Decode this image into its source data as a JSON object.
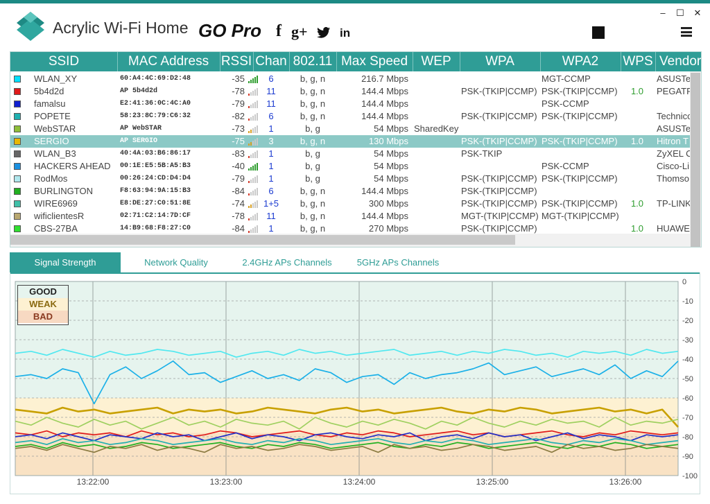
{
  "app": {
    "title": "Acrylic Wi-Fi Home",
    "edition": "GO Pro",
    "social": [
      "f",
      "g+",
      "twitter",
      "in"
    ],
    "window_buttons": [
      "–",
      "☐",
      "✕"
    ],
    "accent_color": "#2f9d96"
  },
  "table": {
    "columns": [
      "SSID",
      "MAC Address",
      "RSSI",
      "Chan",
      "802.11",
      "Max Speed",
      "WEP",
      "WPA",
      "WPA2",
      "WPS",
      "Vendor"
    ],
    "rows": [
      {
        "color": "#00e0ff",
        "ssid": "WLAN_XY",
        "mac": "60:A4:4C:69:D2:48",
        "rssi": "-35",
        "bars": 5,
        "chan": "6",
        "std": "b, g, n",
        "speed": "216.7 Mbps",
        "wep": "",
        "wpa": "",
        "wpa2": "MGT-CCMP",
        "wps": "",
        "vendor": "ASUSTe"
      },
      {
        "color": "#e01a1a",
        "ssid": "5b4d2d",
        "mac": "AP 5b4d2d",
        "rssi": "-78",
        "bars": 1,
        "chan": "11",
        "std": "b, g, n",
        "speed": "144.4 Mbps",
        "wep": "",
        "wpa": "PSK-(TKIP|CCMP)",
        "wpa2": "PSK-(TKIP|CCMP)",
        "wps": "1.0",
        "vendor": "PEGATR"
      },
      {
        "color": "#1020d0",
        "ssid": "famalsu",
        "mac": "E2:41:36:0C:4C:A0",
        "rssi": "-79",
        "bars": 1,
        "chan": "11",
        "std": "b, g, n",
        "speed": "144.4 Mbps",
        "wep": "",
        "wpa": "",
        "wpa2": "PSK-CCMP",
        "wps": "",
        "vendor": ""
      },
      {
        "color": "#1fb0b0",
        "ssid": "POPETE",
        "mac": "58:23:8C:79:C6:32",
        "rssi": "-82",
        "bars": 1,
        "chan": "6",
        "std": "b, g, n",
        "speed": "144.4 Mbps",
        "wep": "",
        "wpa": "PSK-(TKIP|CCMP)",
        "wpa2": "PSK-(TKIP|CCMP)",
        "wps": "",
        "vendor": "Technico"
      },
      {
        "color": "#8fbf3a",
        "ssid": "WebSTAR",
        "mac": "AP WebSTAR",
        "rssi": "-73",
        "bars": 2,
        "chan": "1",
        "std": "b, g",
        "speed": "54 Mbps",
        "wep": "SharedKey",
        "wpa": "",
        "wpa2": "",
        "wps": "",
        "vendor": "ASUSTe"
      },
      {
        "color": "#e8b800",
        "ssid": "SERGIO",
        "mac": "AP SERGIO",
        "rssi": "-75",
        "bars": 2,
        "chan": "3",
        "std": "b, g, n",
        "speed": "130 Mbps",
        "wep": "",
        "wpa": "PSK-(TKIP|CCMP)",
        "wpa2": "PSK-(TKIP|CCMP)",
        "wps": "1.0",
        "vendor": "Hitron T",
        "selected": true
      },
      {
        "color": "#666666",
        "ssid": "WLAN_B3",
        "mac": "40:4A:03:B6:86:17",
        "rssi": "-83",
        "bars": 1,
        "chan": "1",
        "std": "b, g",
        "speed": "54 Mbps",
        "wep": "",
        "wpa": "PSK-TKIP",
        "wpa2": "",
        "wps": "",
        "vendor": "ZyXEL C"
      },
      {
        "color": "#1a90e0",
        "ssid": "HACKERS AHEAD",
        "mac": "00:1E:E5:5B:A5:B3",
        "rssi": "-40",
        "bars": 5,
        "chan": "1",
        "std": "b, g",
        "speed": "54 Mbps",
        "wep": "",
        "wpa": "",
        "wpa2": "PSK-CCMP",
        "wps": "",
        "vendor": "Cisco-Li"
      },
      {
        "color": "#b0e8ee",
        "ssid": "RodMos",
        "mac": "00:26:24:CD:D4:D4",
        "rssi": "-79",
        "bars": 1,
        "chan": "1",
        "std": "b, g",
        "speed": "54 Mbps",
        "wep": "",
        "wpa": "PSK-(TKIP|CCMP)",
        "wpa2": "PSK-(TKIP|CCMP)",
        "wps": "",
        "vendor": "Thomso"
      },
      {
        "color": "#20b020",
        "ssid": "BURLINGTON",
        "mac": "F8:63:94:9A:15:B3",
        "rssi": "-84",
        "bars": 1,
        "chan": "6",
        "std": "b, g, n",
        "speed": "144.4 Mbps",
        "wep": "",
        "wpa": "PSK-(TKIP|CCMP)",
        "wpa2": "",
        "wps": "",
        "vendor": ""
      },
      {
        "color": "#40c0a8",
        "ssid": "WIRE6969",
        "mac": "E8:DE:27:C0:51:8E",
        "rssi": "-74",
        "bars": 2,
        "chan": "1+5",
        "std": "b, g, n",
        "speed": "300 Mbps",
        "wep": "",
        "wpa": "PSK-(TKIP|CCMP)",
        "wpa2": "PSK-(TKIP|CCMP)",
        "wps": "1.0",
        "vendor": "TP-LINK"
      },
      {
        "color": "#b8a870",
        "ssid": "wificlientesR",
        "mac": "02:71:C2:14:7D:CF",
        "rssi": "-78",
        "bars": 1,
        "chan": "11",
        "std": "b, g, n",
        "speed": "144.4 Mbps",
        "wep": "",
        "wpa": "MGT-(TKIP|CCMP)",
        "wpa2": "MGT-(TKIP|CCMP)",
        "wps": "",
        "vendor": ""
      },
      {
        "color": "#30e030",
        "ssid": "CBS-27BA",
        "mac": "14:B9:68:F8:27:C0",
        "rssi": "-84",
        "bars": 1,
        "chan": "1",
        "std": "b, g, n",
        "speed": "270 Mbps",
        "wep": "",
        "wpa": "PSK-(TKIP|CCMP)",
        "wpa2": "",
        "wps": "1.0",
        "vendor": "HUAWE"
      }
    ]
  },
  "tabs": [
    {
      "label": "Signal Strength",
      "active": true
    },
    {
      "label": "Network Quality",
      "active": false
    },
    {
      "label": "2.4GHz APs Channels",
      "active": false
    },
    {
      "label": "5GHz APs Channels",
      "active": false
    }
  ],
  "chart_data": {
    "type": "line",
    "ylim": [
      -100,
      0
    ],
    "yticks": [
      "0",
      "-10",
      "-20",
      "-30",
      "-40",
      "-50",
      "-60",
      "-70",
      "-80",
      "-90",
      "-100"
    ],
    "xticks": [
      "13:22:00",
      "13:23:00",
      "13:24:00",
      "13:25:00",
      "13:26:00"
    ],
    "legend": [
      "GOOD",
      "WEAK",
      "BAD"
    ],
    "zone_colors": {
      "good": "#e6f4ee",
      "weak": "#fdf1d2",
      "bad": "#f7d9c2"
    },
    "series": [
      {
        "color": "#50e8f0",
        "values": [
          -37,
          -36,
          -38,
          -35,
          -37,
          -39,
          -36,
          -38,
          -37,
          -35,
          -36,
          -38,
          -37,
          -36,
          -39,
          -37,
          -36,
          -38,
          -35,
          -37,
          -36,
          -38,
          -37,
          -36,
          -35,
          -38,
          -37,
          -36,
          -38,
          -36,
          -37,
          -35,
          -36,
          -38,
          -37,
          -39,
          -36,
          -37,
          -36,
          -38,
          -35,
          -37,
          -36
        ]
      },
      {
        "color": "#1ab0e8",
        "values": [
          -49,
          -48,
          -50,
          -45,
          -47,
          -63,
          -48,
          -44,
          -50,
          -46,
          -41,
          -48,
          -47,
          -52,
          -49,
          -46,
          -50,
          -48,
          -51,
          -45,
          -47,
          -52,
          -49,
          -48,
          -53,
          -47,
          -50,
          -48,
          -47,
          -45,
          -42,
          -48,
          -46,
          -44,
          -49,
          -47,
          -45,
          -48,
          -43,
          -50,
          -46,
          -49,
          -41
        ]
      },
      {
        "color": "#c8a000",
        "values": [
          -66,
          -67,
          -68,
          -65,
          -67,
          -66,
          -68,
          -67,
          -66,
          -65,
          -68,
          -66,
          -67,
          -66,
          -68,
          -67,
          -65,
          -66,
          -67,
          -68,
          -66,
          -65,
          -67,
          -66,
          -68,
          -67,
          -66,
          -65,
          -67,
          -68,
          -66,
          -67,
          -65,
          -66,
          -68,
          -67,
          -66,
          -65,
          -67,
          -66,
          -68,
          -66,
          -75
        ]
      },
      {
        "color": "#9fd060",
        "values": [
          -72,
          -74,
          -70,
          -73,
          -75,
          -71,
          -74,
          -72,
          -76,
          -73,
          -70,
          -74,
          -72,
          -75,
          -71,
          -73,
          -74,
          -72,
          -76,
          -70,
          -73,
          -75,
          -72,
          -74,
          -71,
          -73,
          -76,
          -72,
          -74,
          -70,
          -73,
          -75,
          -72,
          -74,
          -71,
          -73,
          -72,
          -75,
          -70,
          -74,
          -72,
          -73,
          -71
        ]
      },
      {
        "color": "#e01a1a",
        "values": [
          -78,
          -79,
          -77,
          -80,
          -78,
          -79,
          -78,
          -80,
          -77,
          -79,
          -78,
          -80,
          -79,
          -77,
          -78,
          -80,
          -79,
          -78,
          -77,
          -79,
          -80,
          -78,
          -79,
          -77,
          -78,
          -80,
          -79,
          -78,
          -77,
          -79,
          -78,
          -80,
          -79,
          -78,
          -77,
          -79,
          -80,
          -78,
          -79,
          -77,
          -78,
          -79,
          -78
        ]
      },
      {
        "color": "#2030c8",
        "values": [
          -80,
          -79,
          -81,
          -78,
          -80,
          -82,
          -79,
          -80,
          -81,
          -78,
          -80,
          -79,
          -82,
          -80,
          -78,
          -81,
          -79,
          -80,
          -82,
          -79,
          -78,
          -80,
          -81,
          -79,
          -80,
          -78,
          -82,
          -80,
          -79,
          -81,
          -78,
          -80,
          -79,
          -82,
          -80,
          -78,
          -81,
          -79,
          -80,
          -82,
          -79,
          -80,
          -79
        ]
      },
      {
        "color": "#20b0b0",
        "values": [
          -83,
          -82,
          -84,
          -81,
          -83,
          -82,
          -84,
          -83,
          -81,
          -82,
          -84,
          -83,
          -82,
          -81,
          -83,
          -84,
          -82,
          -83,
          -81,
          -82,
          -84,
          -83,
          -82,
          -81,
          -83,
          -84,
          -82,
          -83,
          -81,
          -82,
          -84,
          -83,
          -82,
          -81,
          -83,
          -84,
          -82,
          -83,
          -81,
          -82,
          -84,
          -83,
          -82
        ]
      },
      {
        "color": "#20b020",
        "values": [
          -85,
          -84,
          -86,
          -83,
          -85,
          -84,
          -86,
          -85,
          -83,
          -84,
          -86,
          -85,
          -84,
          -83,
          -85,
          -86,
          -84,
          -85,
          -83,
          -84,
          -86,
          -85,
          -84,
          -83,
          -85,
          -86,
          -84,
          -85,
          -83,
          -84,
          -86,
          -85,
          -84,
          -83,
          -85,
          -86,
          -84,
          -85,
          -83,
          -84,
          -86,
          -85,
          -84
        ]
      },
      {
        "color": "#8a7a40",
        "values": [
          -86,
          -85,
          -87,
          -84,
          -86,
          -88,
          -85,
          -86,
          -84,
          -87,
          -85,
          -86,
          -88,
          -84,
          -86,
          -85,
          -87,
          -86,
          -84,
          -85,
          -87,
          -86,
          -85,
          -88,
          -84,
          -86,
          -85,
          -87,
          -86,
          -84,
          -85,
          -87,
          -86,
          -85,
          -88,
          -84,
          -86,
          -85,
          -87,
          -86,
          -84,
          -85,
          -86
        ]
      }
    ]
  }
}
